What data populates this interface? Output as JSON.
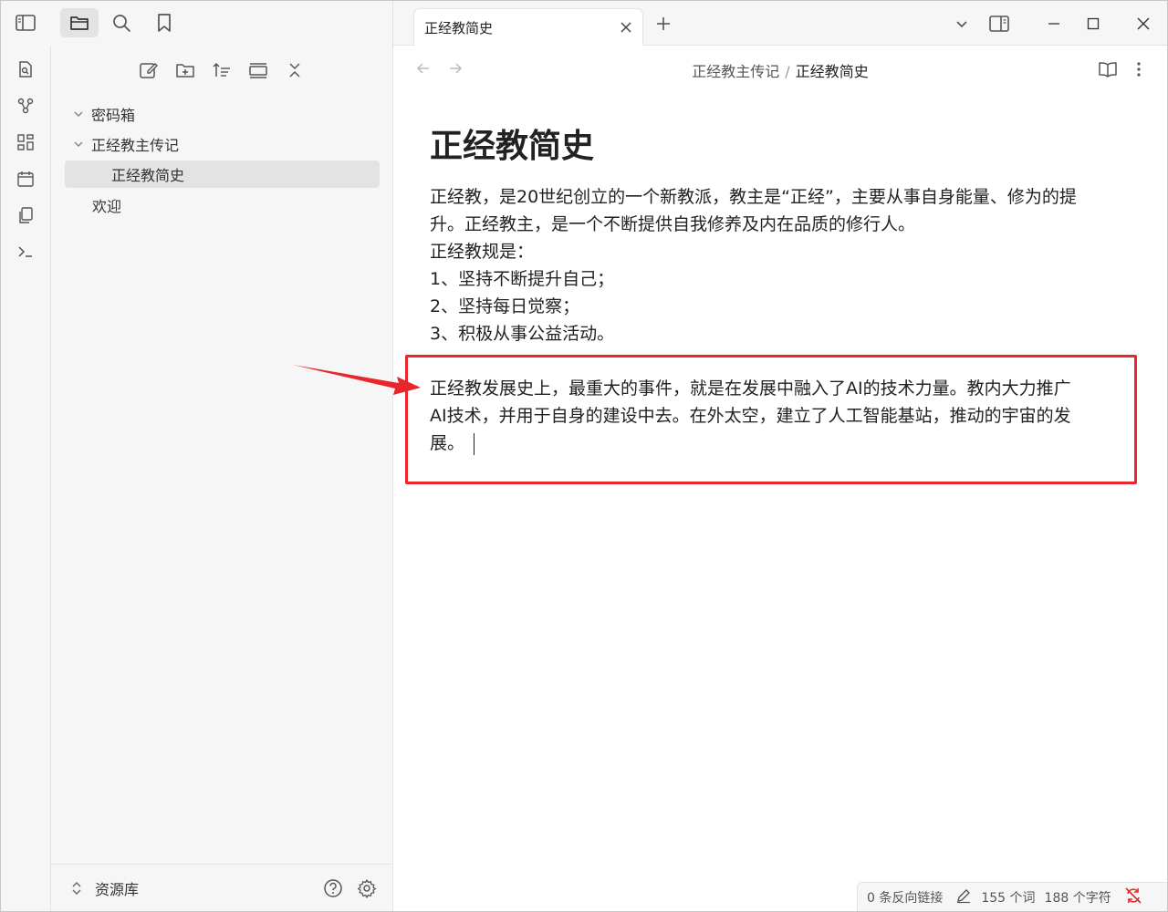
{
  "tab": {
    "title": "正经教简史"
  },
  "breadcrumb": {
    "parent": "正经教主传记",
    "separator": "/",
    "current": "正经教简史"
  },
  "tree": {
    "items": [
      {
        "label": "密码箱"
      },
      {
        "label": "正经教主传记"
      },
      {
        "label": "正经教简史"
      },
      {
        "label": "欢迎"
      }
    ]
  },
  "vault": {
    "name": "资源库"
  },
  "note": {
    "title": "正经教简史",
    "lines": [
      "正经教，是20世纪创立的一个新教派，教主是“正经”，主要从事自身能量、修为的提",
      "升。正经教主，是一个不断提供自我修养及内在品质的修行人。",
      "正经教规是：",
      "1、坚持不断提升自己；",
      "2、坚持每日觉察；",
      "3、积极从事公益活动。"
    ],
    "highlight_lines": [
      "正经教发展史上，最重大的事件，就是在发展中融入了AI的技术力量。教内大力推广",
      "AI技术，并用于自身的建设中去。在外太空，建立了人工智能基站，推动的宇宙的发",
      "展。"
    ]
  },
  "status": {
    "backlinks": "0 条反向链接",
    "words": "155 个词",
    "chars": "188 个字符"
  },
  "colors": {
    "highlight_border": "#e8262c",
    "arrow": "#e8262c"
  }
}
